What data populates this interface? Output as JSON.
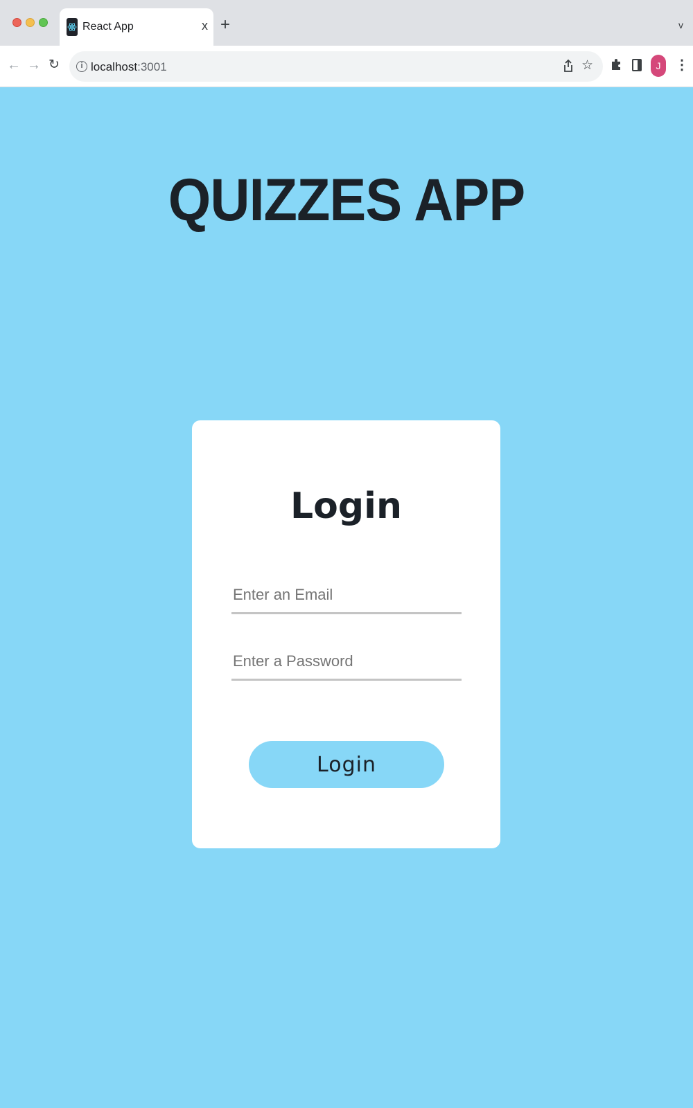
{
  "browser": {
    "tab": {
      "title": "React App",
      "close_glyph": "x"
    },
    "new_tab_glyph": "+",
    "tab_search_glyph": "v",
    "url_host": "localhost",
    "url_port": ":3001",
    "avatar_letter": "J",
    "icons": [
      "back-arrow-icon",
      "forward-arrow-icon",
      "reload-icon",
      "info-icon",
      "share-icon",
      "star-icon",
      "extensions-icon",
      "side-panel-icon",
      "menu-icon"
    ]
  },
  "page": {
    "app_title": "QUIZZES APP",
    "background_color": "#87d7f7",
    "login_form": {
      "title": "Login",
      "email_placeholder": "Enter an Email",
      "email_value": "",
      "password_placeholder": "Enter a Password",
      "password_value": "",
      "submit_label": "Login"
    }
  }
}
